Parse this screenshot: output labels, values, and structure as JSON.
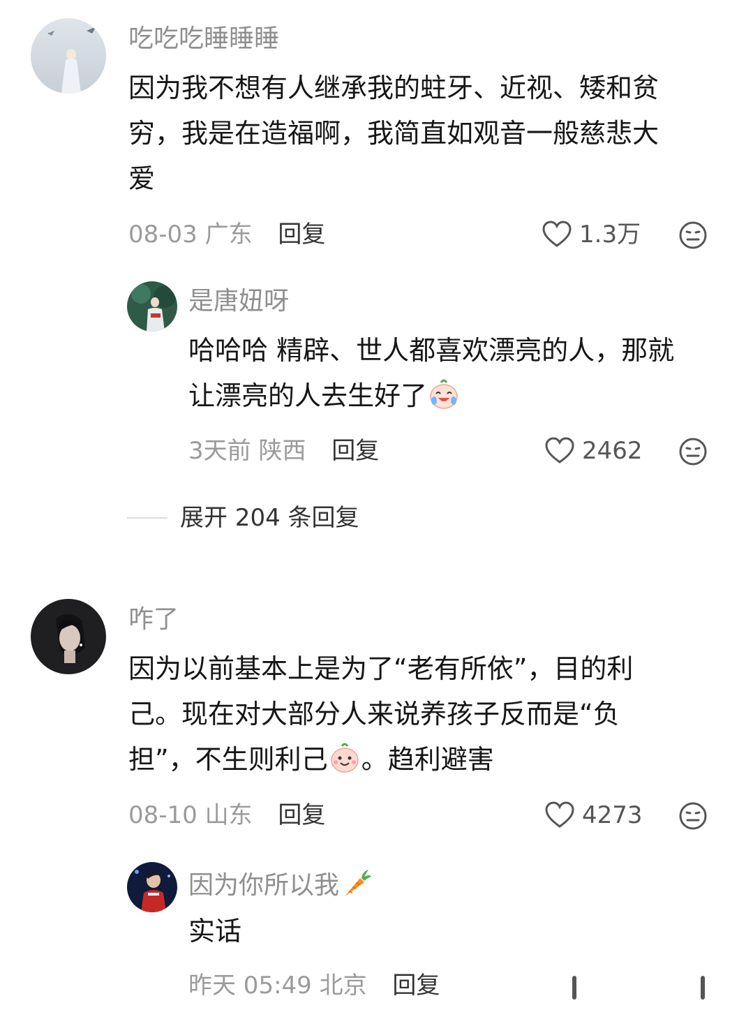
{
  "comments": [
    {
      "username": "吃吃吃睡睡睡",
      "lines": [
        "因为我不想有人继承我的蛀牙、近视、矮和贫",
        "穷，我是在造福啊，我简直如观音一般慈悲大",
        "爱"
      ],
      "date": "08-03",
      "location": "广东",
      "reply_label": "回复",
      "likes": "1.3万",
      "replies": [
        {
          "username": "是唐妞呀",
          "lines": [
            "哈哈哈 精辟、世人都喜欢漂亮的人，那就",
            "让漂亮的人去生好了"
          ],
          "date": "3天前",
          "location": "陕西",
          "reply_label": "回复",
          "likes": "2462"
        }
      ],
      "expand_label": "展开 204 条回复"
    },
    {
      "username": "咋了",
      "lines": [
        "因为以前基本上是为了“老有所依”，目的利",
        "己。现在对大部分人来说养孩子反而是“负",
        "担”，不生则利己",
        "。趋利避害"
      ],
      "date": "08-10",
      "location": "山东",
      "reply_label": "回复",
      "likes": "4273",
      "replies": [
        {
          "username": "因为你所以我",
          "lines": [
            "实话"
          ],
          "date": "昨天 05:49",
          "location": "北京",
          "reply_label": "回复"
        }
      ]
    }
  ],
  "icons": {
    "like": "heart-outline-icon",
    "dislike": "neutral-face-icon",
    "emoji_laugh_cry": "laugh-cry-emoji",
    "emoji_smile": "smile-emoji",
    "emoji_carrot": "carrot-emoji"
  },
  "colors": {
    "text": "#161616",
    "secondary": "#8f8f8f",
    "meta": "#9a9a9a",
    "background": "#ffffff"
  }
}
